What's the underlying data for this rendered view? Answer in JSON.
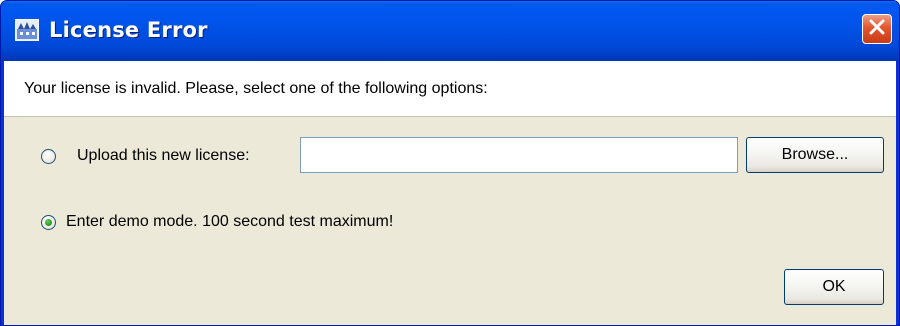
{
  "window": {
    "title": "License Error",
    "title_icon": "app-icon",
    "close_icon": "close-icon"
  },
  "message": "Your license is invalid.  Please, select one of the following options:",
  "options": {
    "upload": {
      "label": "Upload this new license:",
      "selected": false,
      "input_value": "",
      "input_placeholder": "",
      "browse_label": "Browse..."
    },
    "demo": {
      "label": "Enter demo mode.  100 second test maximum!",
      "selected": true
    }
  },
  "ok_label": "OK",
  "colors": {
    "titlebar": "#0053e8",
    "panel": "#ece9d8",
    "close_button": "#e2552f",
    "radio_selected": "#2b9e24"
  }
}
